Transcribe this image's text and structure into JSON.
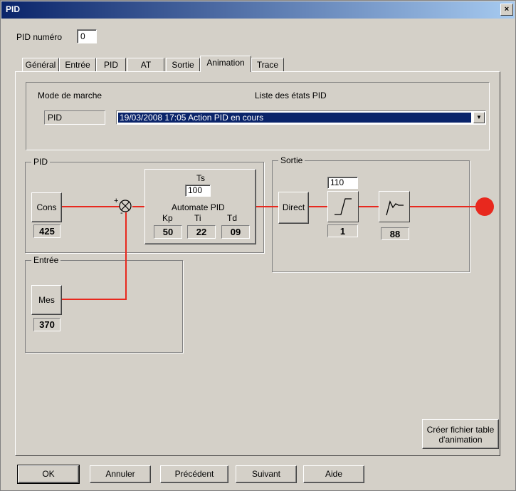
{
  "window": {
    "title": "PID",
    "close": "×"
  },
  "pid_numero": {
    "label": "PID numéro",
    "value": "0"
  },
  "tabs": [
    {
      "label": "Général"
    },
    {
      "label": "Entrée"
    },
    {
      "label": "PID"
    },
    {
      "label": "AT"
    },
    {
      "label": "Sortie"
    },
    {
      "label": "Animation"
    },
    {
      "label": "Trace"
    }
  ],
  "mode": {
    "label": "Mode de marche",
    "value": "PID"
  },
  "states": {
    "label": "Liste des états PID",
    "selected": "19/03/2008 17:05 Action PID en cours"
  },
  "pid_group": {
    "title": "PID",
    "cons_label": "Cons",
    "cons_value": "425",
    "plus": "+",
    "minus": "-",
    "ts_label": "Ts",
    "ts_value": "100",
    "automate_label": "Automate PID",
    "kp_label": "Kp",
    "ti_label": "Ti",
    "td_label": "Td",
    "kp_value": "50",
    "ti_value": "22",
    "td_value": "09"
  },
  "entree_group": {
    "title": "Entrée",
    "mes_label": "Mes",
    "mes_value": "370"
  },
  "sortie_group": {
    "title": "Sortie",
    "direct_label": "Direct",
    "limit_value": "110",
    "step_value": "1",
    "response_value": "88"
  },
  "create_button": {
    "line1": "Créer fichier table",
    "line2": "d'animation"
  },
  "buttons": {
    "ok": "OK",
    "cancel": "Annuler",
    "prev": "Précédent",
    "next": "Suivant",
    "help": "Aide"
  },
  "colors": {
    "signal": "#e8281e",
    "selection": "#0a246a",
    "title_gradient_start": "#0a246a"
  }
}
